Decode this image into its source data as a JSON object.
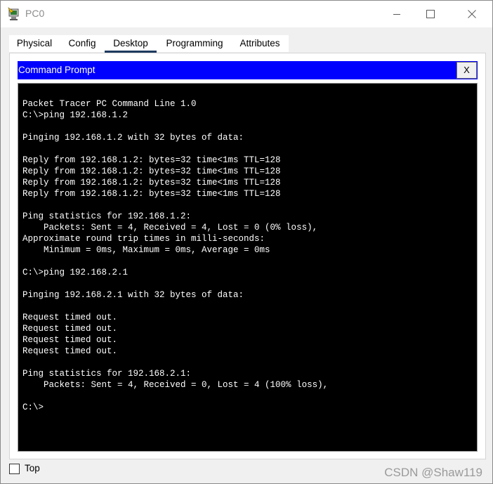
{
  "window": {
    "title": "PC0"
  },
  "tabs": [
    {
      "label": "Physical"
    },
    {
      "label": "Config"
    },
    {
      "label": "Desktop",
      "active": true
    },
    {
      "label": "Programming"
    },
    {
      "label": "Attributes"
    }
  ],
  "command_prompt": {
    "title": "Command Prompt",
    "close_label": "X",
    "header_color": "#0000ff",
    "output": "Packet Tracer PC Command Line 1.0\nC:\\>ping 192.168.1.2\n\nPinging 192.168.1.2 with 32 bytes of data:\n\nReply from 192.168.1.2: bytes=32 time<1ms TTL=128\nReply from 192.168.1.2: bytes=32 time<1ms TTL=128\nReply from 192.168.1.2: bytes=32 time<1ms TTL=128\nReply from 192.168.1.2: bytes=32 time<1ms TTL=128\n\nPing statistics for 192.168.1.2:\n    Packets: Sent = 4, Received = 4, Lost = 0 (0% loss),\nApproximate round trip times in milli-seconds:\n    Minimum = 0ms, Maximum = 0ms, Average = 0ms\n\nC:\\>ping 192.168.2.1\n\nPinging 192.168.2.1 with 32 bytes of data:\n\nRequest timed out.\nRequest timed out.\nRequest timed out.\nRequest timed out.\n\nPing statistics for 192.168.2.1:\n    Packets: Sent = 4, Received = 0, Lost = 4 (100% loss),\n\nC:\\>"
  },
  "footer": {
    "top_label": "Top",
    "top_checked": false,
    "watermark": "CSDN @Shaw119"
  },
  "icons": {
    "app": "packet-tracer-pc-icon",
    "minimize": "minimize-icon",
    "maximize": "maximize-icon",
    "close": "close-icon"
  }
}
